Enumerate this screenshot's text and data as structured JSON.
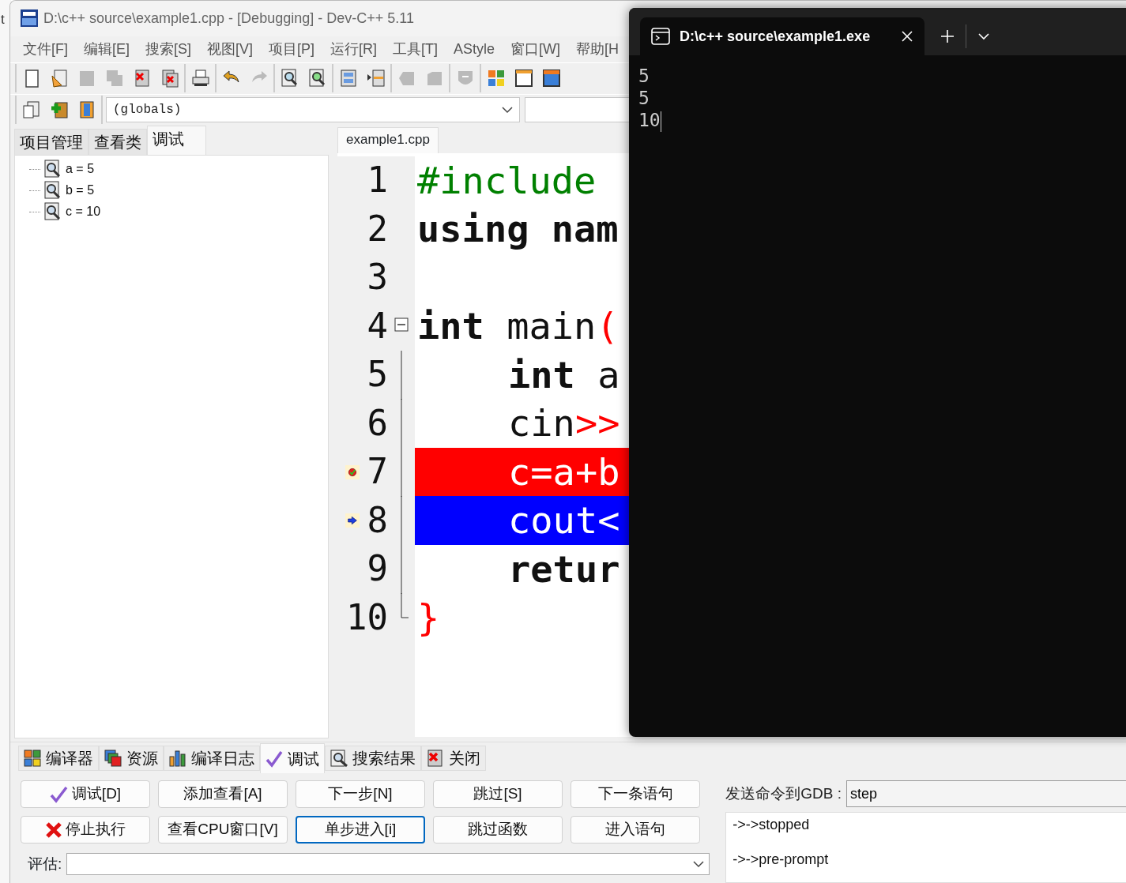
{
  "background_window": {
    "text": "t"
  },
  "window": {
    "title": "D:\\c++ source\\example1.cpp - [Debugging] - Dev-C++ 5.11"
  },
  "menu": [
    "文件[F]",
    "编辑[E]",
    "搜索[S]",
    "视图[V]",
    "项目[P]",
    "运行[R]",
    "工具[T]",
    "AStyle",
    "窗口[W]",
    "帮助[H"
  ],
  "toolbar": [
    {
      "kind": "new",
      "disabled": false
    },
    {
      "kind": "open",
      "disabled": false
    },
    {
      "kind": "save",
      "disabled": true
    },
    {
      "kind": "save-all",
      "disabled": true
    },
    {
      "kind": "close",
      "disabled": false
    },
    {
      "kind": "close-all",
      "disabled": false
    },
    {
      "kind": "sep"
    },
    {
      "kind": "print",
      "disabled": false
    },
    {
      "kind": "sep"
    },
    {
      "kind": "undo",
      "disabled": false
    },
    {
      "kind": "redo",
      "disabled": true
    },
    {
      "kind": "sep"
    },
    {
      "kind": "find",
      "disabled": false
    },
    {
      "kind": "replace",
      "disabled": false
    },
    {
      "kind": "sep"
    },
    {
      "kind": "indent",
      "disabled": false
    },
    {
      "kind": "unindent",
      "disabled": false
    },
    {
      "kind": "sep"
    },
    {
      "kind": "prev",
      "disabled": true
    },
    {
      "kind": "next",
      "disabled": true
    },
    {
      "kind": "sep"
    },
    {
      "kind": "toggle",
      "disabled": true
    },
    {
      "kind": "sep"
    },
    {
      "kind": "grid",
      "disabled": false
    },
    {
      "kind": "window",
      "disabled": false
    },
    {
      "kind": "window2",
      "disabled": false
    }
  ],
  "toolbar2": [
    {
      "kind": "project",
      "disabled": false
    },
    {
      "kind": "add",
      "disabled": false
    },
    {
      "kind": "book",
      "disabled": false
    }
  ],
  "scope_box": {
    "value": "(globals)"
  },
  "left_tabs": [
    {
      "label": "项目管理",
      "selected": false
    },
    {
      "label": "查看类",
      "selected": false
    },
    {
      "label": "调试",
      "selected": true
    }
  ],
  "watches": [
    {
      "text": "a = 5"
    },
    {
      "text": "b = 5"
    },
    {
      "text": "c = 10"
    }
  ],
  "editor": {
    "tab": "example1.cpp",
    "lines": [
      {
        "number": "1",
        "indented": false,
        "tokens": [
          {
            "kind": "preprocessor",
            "text": "#include"
          }
        ],
        "breakpoint": false,
        "current": false,
        "fold_start": false,
        "in_fold": false
      },
      {
        "number": "2",
        "indented": false,
        "tokens": [
          {
            "kind": "keyword",
            "text": "using"
          },
          {
            "kind": "keyword",
            "text": " nam"
          }
        ],
        "breakpoint": false,
        "current": false,
        "fold_start": false,
        "in_fold": false
      },
      {
        "number": "3",
        "breakpoint": false,
        "current": false,
        "fold_start": false,
        "in_fold": false
      },
      {
        "number": "4",
        "indented": false,
        "tokens": [
          {
            "kind": "keyword",
            "text": "int"
          },
          {
            "kind": "plain",
            "text": " main"
          },
          {
            "kind": "operator",
            "text": "("
          }
        ],
        "breakpoint": false,
        "current": false,
        "fold_start": true,
        "in_fold": false
      },
      {
        "number": "5",
        "indented": true,
        "tokens": [
          {
            "kind": "keyword",
            "text": "int"
          },
          {
            "kind": "plain",
            "text": " a"
          }
        ],
        "breakpoint": false,
        "current": false,
        "fold_start": false,
        "in_fold": true
      },
      {
        "number": "6",
        "indented": true,
        "tokens": [
          {
            "kind": "plain",
            "text": "cin"
          },
          {
            "kind": "operator",
            "text": ">>"
          }
        ],
        "breakpoint": false,
        "current": false,
        "fold_start": false,
        "in_fold": true
      },
      {
        "number": "7",
        "indented": true,
        "tokens": [
          {
            "kind": "plain",
            "text": "c=a+b"
          }
        ],
        "breakpoint": true,
        "current": false,
        "fold_start": false,
        "in_fold": true
      },
      {
        "number": "8",
        "indented": true,
        "tokens": [
          {
            "kind": "plain",
            "text": "cout"
          },
          {
            "kind": "operator",
            "text": "<"
          }
        ],
        "breakpoint": false,
        "current": true,
        "fold_start": false,
        "in_fold": true
      },
      {
        "number": "9",
        "indented": true,
        "tokens": [
          {
            "kind": "keyword",
            "text": "retur"
          }
        ],
        "breakpoint": false,
        "current": false,
        "fold_start": false,
        "in_fold": true
      },
      {
        "number": "10",
        "indented": false,
        "tokens": [
          {
            "kind": "operator",
            "text": "}"
          }
        ],
        "breakpoint": false,
        "current": false,
        "fold_start": false,
        "in_fold": true
      }
    ]
  },
  "bottom_tabs": [
    {
      "label": "编译器",
      "kind": "grid",
      "selected": false
    },
    {
      "label": "资源",
      "kind": "resources",
      "selected": false
    },
    {
      "label": "编译日志",
      "kind": "chart",
      "selected": false
    },
    {
      "label": "调试",
      "kind": "check",
      "selected": true
    },
    {
      "label": "搜索结果",
      "kind": "find",
      "selected": false
    },
    {
      "label": "关闭",
      "kind": "close",
      "selected": false
    }
  ],
  "debug_buttons": [
    {
      "label": "调试[D]",
      "kind": "check",
      "focused": false
    },
    {
      "label": "添加查看[A]",
      "kind": "plain",
      "focused": false
    },
    {
      "label": "下一步[N]",
      "kind": "plain",
      "focused": false
    },
    {
      "label": "跳过[S]",
      "kind": "plain",
      "focused": false
    },
    {
      "label": "下一条语句",
      "kind": "plain",
      "focused": false
    },
    {
      "label": "停止执行",
      "kind": "stop",
      "focused": false
    },
    {
      "label": "查看CPU窗口[V]",
      "kind": "plain",
      "focused": false
    },
    {
      "label": "单步进入[i]",
      "kind": "plain",
      "focused": true
    },
    {
      "label": "跳过函数",
      "kind": "plain",
      "focused": false
    },
    {
      "label": "进入语句",
      "kind": "plain",
      "focused": false
    }
  ],
  "evaluate": {
    "label": "评估:"
  },
  "gdb": {
    "label": "发送命令到GDB :",
    "value": "step",
    "output": [
      {
        "lines": [
          "->->stopped"
        ]
      },
      {
        "lines": [
          "->->pre-prompt"
        ]
      }
    ]
  },
  "terminal": {
    "tab_title": "D:\\c++ source\\example1.exe",
    "output": [
      "5",
      "5",
      "10"
    ]
  }
}
